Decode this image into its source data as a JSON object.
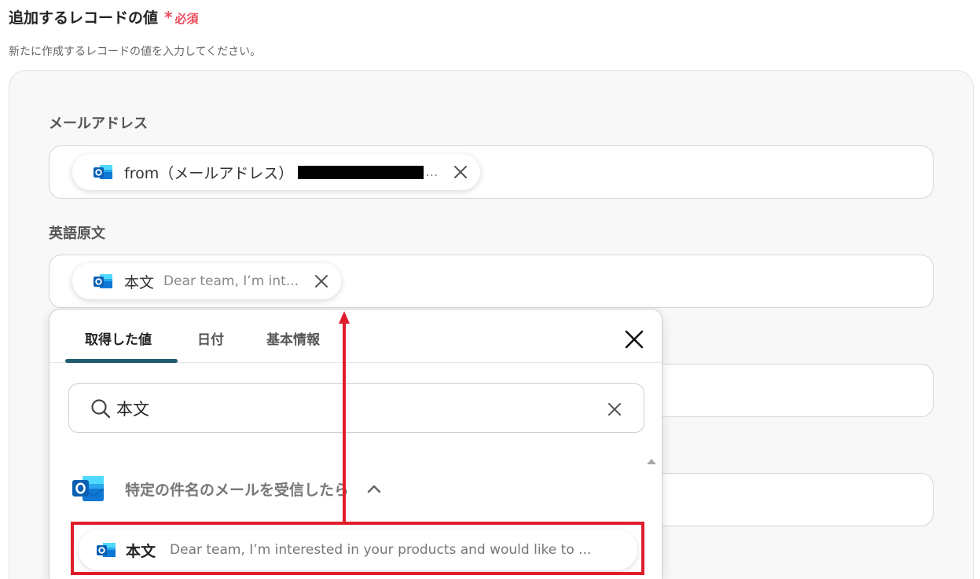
{
  "section": {
    "title": "追加するレコードの値",
    "required_star": "*",
    "required_label": "必須",
    "description": "新たに作成するレコードの値を入力してください。"
  },
  "fields": [
    {
      "label": "メールアドレス",
      "chip": {
        "icon": "outlook-icon",
        "label": "from（メールアドレス）",
        "value_redacted": true,
        "ellipsis": "..."
      }
    },
    {
      "label": "英語原文",
      "chip": {
        "icon": "outlook-icon",
        "label": "本文",
        "value": "Dear team, I’m int..."
      }
    }
  ],
  "dropdown": {
    "tabs": [
      {
        "label": "取得した値",
        "active": true
      },
      {
        "label": "日付",
        "active": false
      },
      {
        "label": "基本情報",
        "active": false
      }
    ],
    "search_value": "本文",
    "group": {
      "icon": "outlook-icon",
      "label": "特定の件名のメールを受信したら",
      "expanded": true
    },
    "results": [
      {
        "icon": "outlook-icon",
        "label": "本文",
        "value": "Dear team, I’m interested in your products and would like to ..."
      }
    ]
  },
  "colors": {
    "required": "#ec4a5c",
    "tab_underline": "#1f5d6e",
    "highlight": "#e01e2b",
    "outlook_blue": "#0f78d4"
  }
}
